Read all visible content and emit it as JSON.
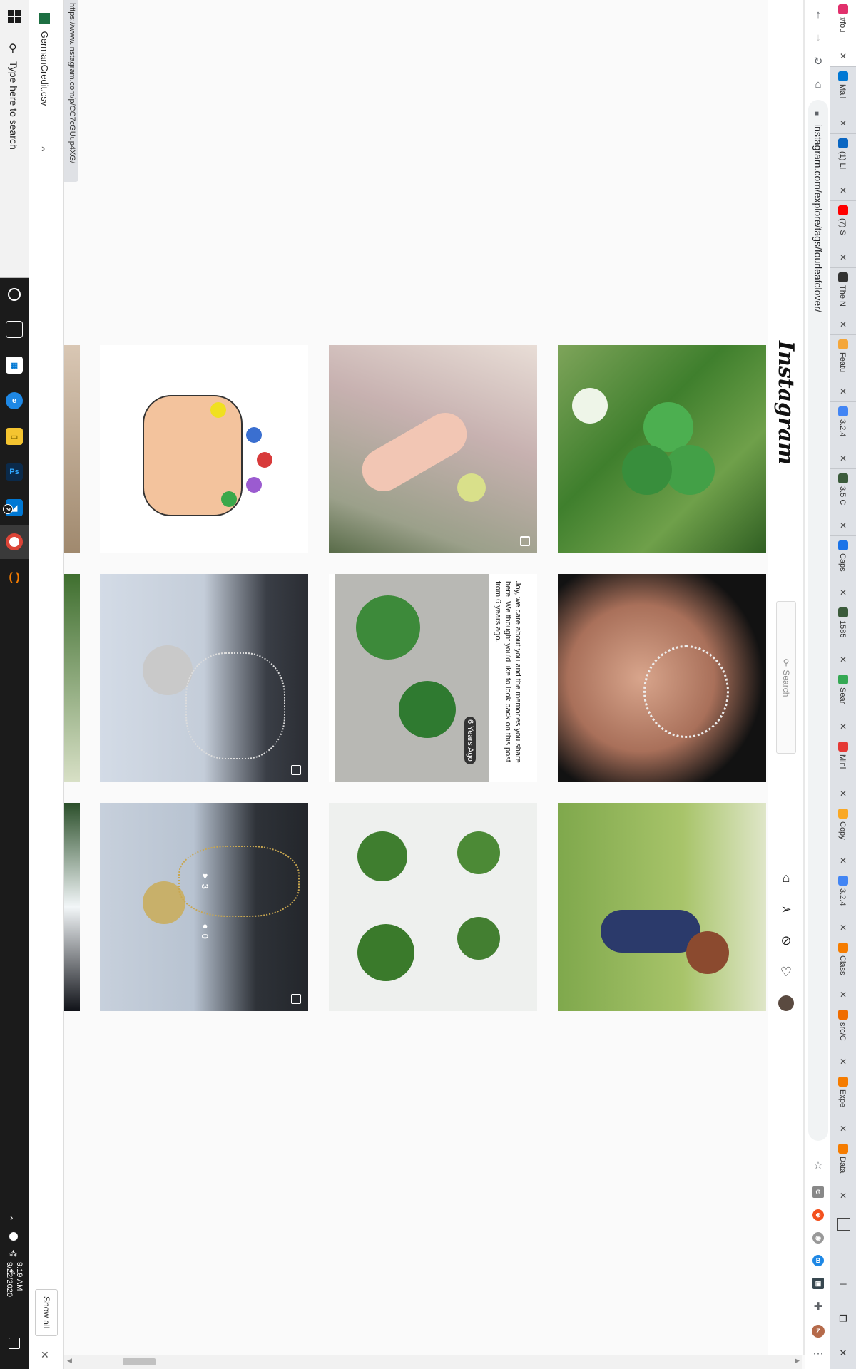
{
  "taskbar": {
    "search_placeholder": "Type here to search",
    "badge": "2",
    "clock_time": "9:19 AM",
    "clock_date": "9/22/2020",
    "icons": [
      "cortana-icon",
      "task-view-icon",
      "store-icon",
      "edge-icon",
      "file-explorer-icon",
      "photoshop-icon",
      "vscode-icon",
      "chrome-icon",
      "taskbar-app-icon"
    ]
  },
  "download_bar": {
    "file_name": "GermanCredit.csv",
    "show_all": "Show all"
  },
  "status_url": "https://www.instagram.com/p/CC7cGUup4XG/",
  "toolbar": {
    "url": "instagram.com/explore/tags/fourleafclover/"
  },
  "instagram": {
    "logo": "Instagram",
    "search_placeholder": "Search",
    "overlay_likes": "3",
    "overlay_comments": "0",
    "memory_text": "Joy, we care about you and the memories you share here. We thought you'd like to look back on this post from 6 years ago.",
    "memory_badge": "6 Years Ago"
  },
  "tabs": [
    {
      "title": "#fou",
      "color": "#e1306c"
    },
    {
      "title": "Mail",
      "color": "#0078d4"
    },
    {
      "title": "(1) Li",
      "color": "#0a66c2"
    },
    {
      "title": "(7) S",
      "color": "#ff0000"
    },
    {
      "title": "The N",
      "color": "#333333"
    },
    {
      "title": "Featu",
      "color": "#f4a63a"
    },
    {
      "title": "3.2.4",
      "color": "#4285f4"
    },
    {
      "title": "3.5 C",
      "color": "#3b5b3b"
    },
    {
      "title": "Caps",
      "color": "#1a73e8"
    },
    {
      "title": "1585",
      "color": "#3b5b3b"
    },
    {
      "title": "Sear",
      "color": "#34a853"
    },
    {
      "title": "Mini",
      "color": "#e53935"
    },
    {
      "title": "Copy",
      "color": "#f9a825"
    },
    {
      "title": "3.2.4",
      "color": "#4285f4"
    },
    {
      "title": "Class",
      "color": "#f57c00"
    },
    {
      "title": "src/C",
      "color": "#ef6c00"
    },
    {
      "title": "Expe",
      "color": "#f57c00"
    },
    {
      "title": "Data",
      "color": "#f57c00"
    }
  ]
}
